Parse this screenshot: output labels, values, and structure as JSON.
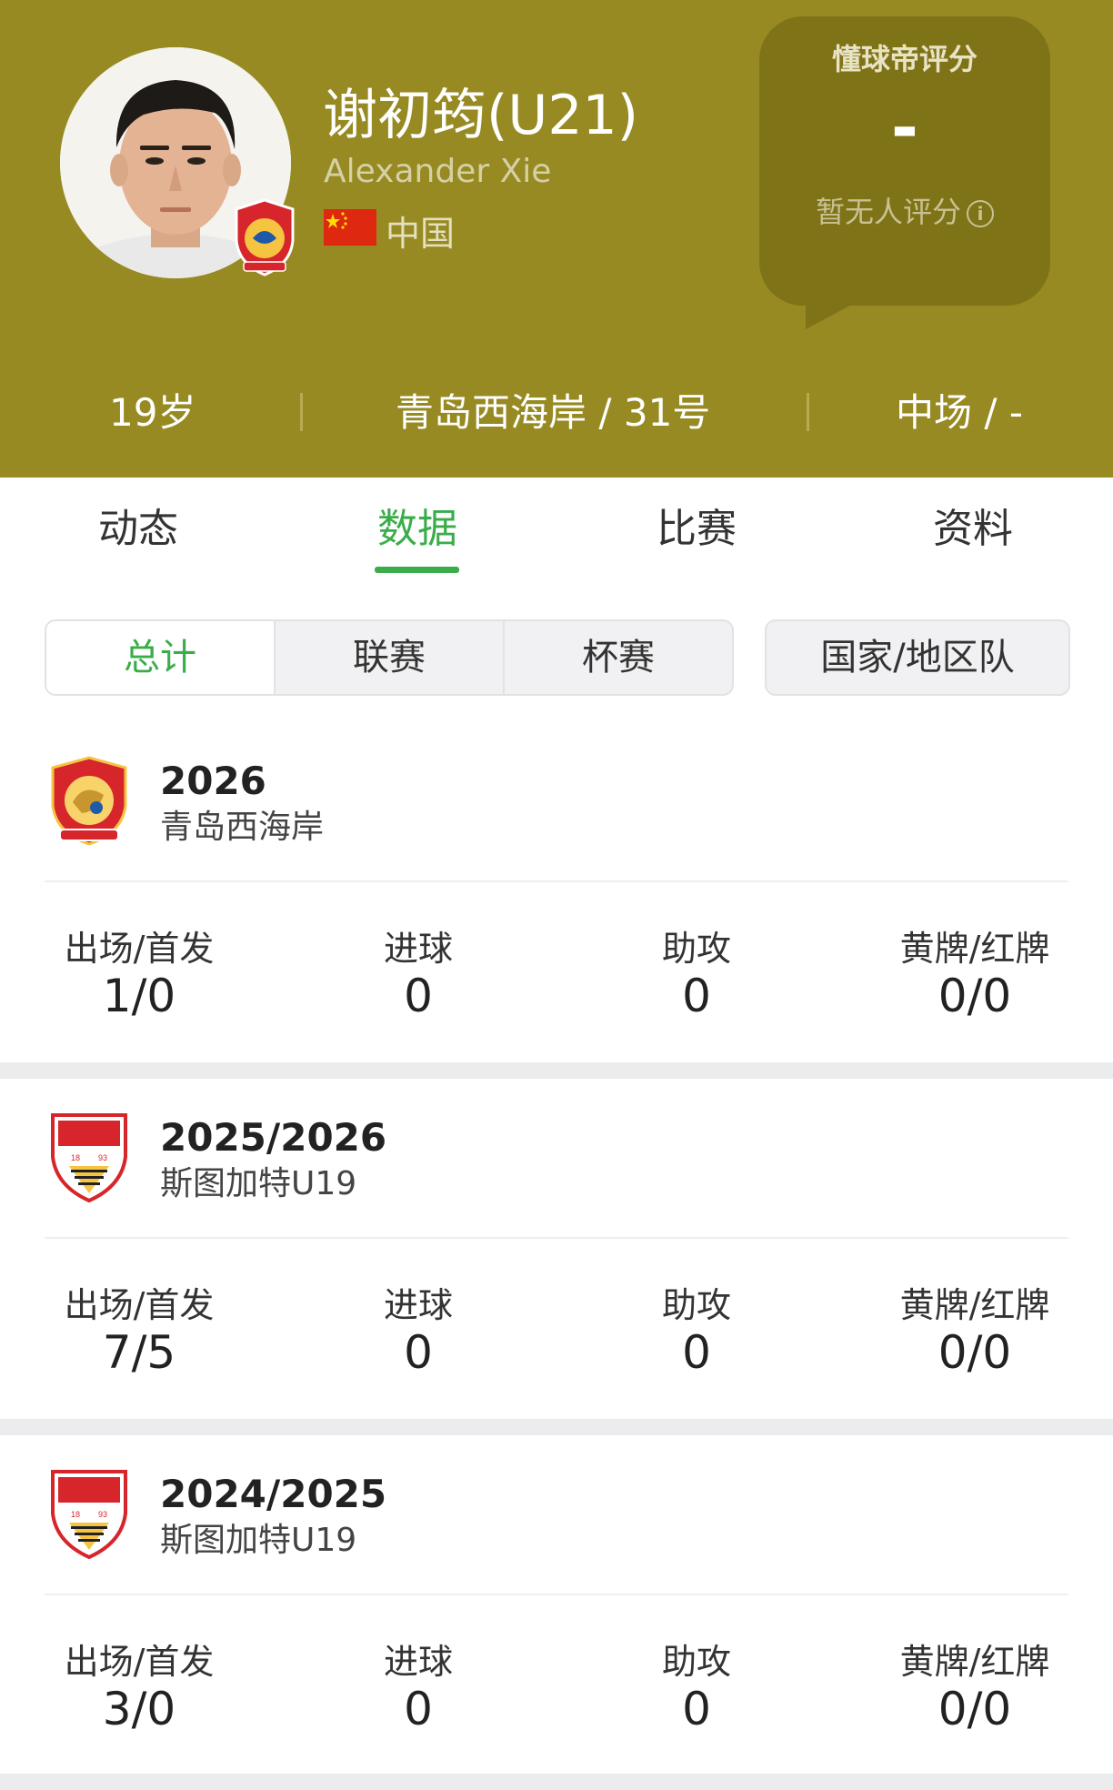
{
  "player": {
    "name": "谢初筠(U21)",
    "name_en": "Alexander Xie",
    "country": "中国",
    "age": "19岁",
    "club_number": "青岛西海岸 / 31号",
    "position": "中场 / -"
  },
  "rating": {
    "title": "懂球帝评分",
    "value": "-",
    "note": "暂无人评分"
  },
  "tabs": [
    {
      "label": "动态"
    },
    {
      "label": "数据"
    },
    {
      "label": "比赛"
    },
    {
      "label": "资料"
    }
  ],
  "active_tab": "数据",
  "filters": [
    {
      "label": "总计"
    },
    {
      "label": "联赛"
    },
    {
      "label": "杯赛"
    },
    {
      "label": "国家/地区队"
    }
  ],
  "stat_labels": {
    "apps": "出场/首发",
    "goals": "进球",
    "assists": "助攻",
    "cards": "黄牌/红牌"
  },
  "seasons": [
    {
      "season": "2026",
      "team": "青岛西海岸",
      "apps": "1/0",
      "goals": "0",
      "assists": "0",
      "cards": "0/0"
    },
    {
      "season": "2025/2026",
      "team": "斯图加特U19",
      "apps": "7/5",
      "goals": "0",
      "assists": "0",
      "cards": "0/0"
    },
    {
      "season": "2024/2025",
      "team": "斯图加特U19",
      "apps": "3/0",
      "goals": "0",
      "assists": "0",
      "cards": "0/0"
    }
  ],
  "colors": {
    "header_bg": "#978a22",
    "accent_green": "#3aad4a"
  }
}
